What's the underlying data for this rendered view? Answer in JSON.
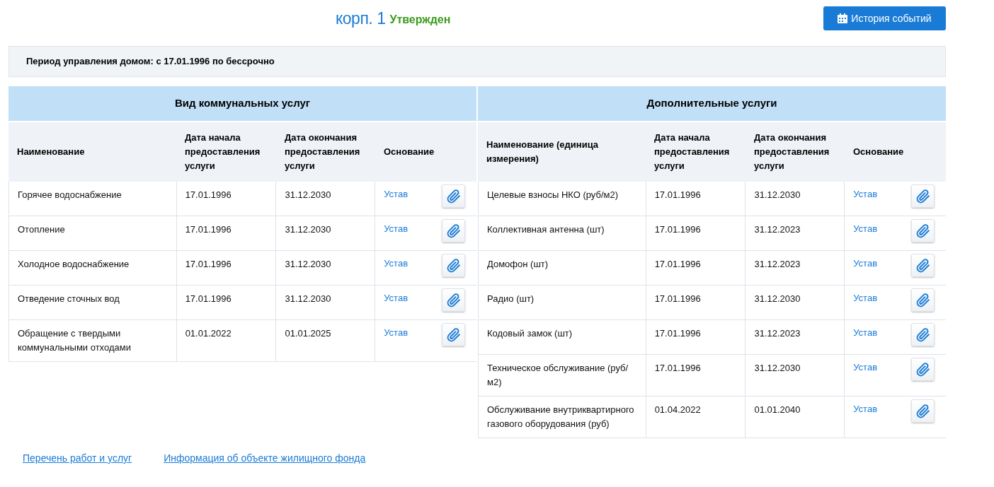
{
  "header": {
    "title": "корп. 1",
    "status": "Утвержден",
    "history_button": "История событий"
  },
  "period": {
    "label": "Период управления домом:",
    "value": "с 17.01.1996 по бессрочно"
  },
  "tables": [
    {
      "title": "Вид коммунальных услуг",
      "columns": [
        "Наименование",
        "Дата начала предоставления услуги",
        "Дата окончания предоставления услуги",
        "Основание"
      ],
      "rows": [
        {
          "name": "Горячее водоснабжение",
          "start": "17.01.1996",
          "end": "31.12.2030",
          "basis": "Устав"
        },
        {
          "name": "Отопление",
          "start": "17.01.1996",
          "end": "31.12.2030",
          "basis": "Устав"
        },
        {
          "name": "Холодное водоснабжение",
          "start": "17.01.1996",
          "end": "31.12.2030",
          "basis": "Устав"
        },
        {
          "name": "Отведение сточных вод",
          "start": "17.01.1996",
          "end": "31.12.2030",
          "basis": "Устав"
        },
        {
          "name": "Обращение с твердыми коммунальными отходами",
          "start": "01.01.2022",
          "end": "01.01.2025",
          "basis": "Устав"
        }
      ]
    },
    {
      "title": "Дополнительные услуги",
      "columns": [
        "Наименование (единица измерения)",
        "Дата начала предоставления услуги",
        "Дата окончания предоставления услуги",
        "Основание"
      ],
      "rows": [
        {
          "name": "Целевые взносы НКО (руб/м2)",
          "start": "17.01.1996",
          "end": "31.12.2030",
          "basis": "Устав"
        },
        {
          "name": "Коллективная антенна (шт)",
          "start": "17.01.1996",
          "end": "31.12.2023",
          "basis": "Устав"
        },
        {
          "name": "Домофон (шт)",
          "start": "17.01.1996",
          "end": "31.12.2023",
          "basis": "Устав"
        },
        {
          "name": "Радио (шт)",
          "start": "17.01.1996",
          "end": "31.12.2030",
          "basis": "Устав"
        },
        {
          "name": "Кодовый замок (шт)",
          "start": "17.01.1996",
          "end": "31.12.2023",
          "basis": "Устав"
        },
        {
          "name": "Техническое обслуживание (руб/м2)",
          "start": "17.01.1996",
          "end": "31.12.2030",
          "basis": "Устав"
        },
        {
          "name": "Обслуживание внутриквартирного газового оборудования (руб)",
          "start": "01.04.2022",
          "end": "01.01.2040",
          "basis": "Устав"
        }
      ]
    }
  ],
  "links": [
    "Перечень работ и услуг",
    "Информация об объекте жилищного фонда"
  ]
}
